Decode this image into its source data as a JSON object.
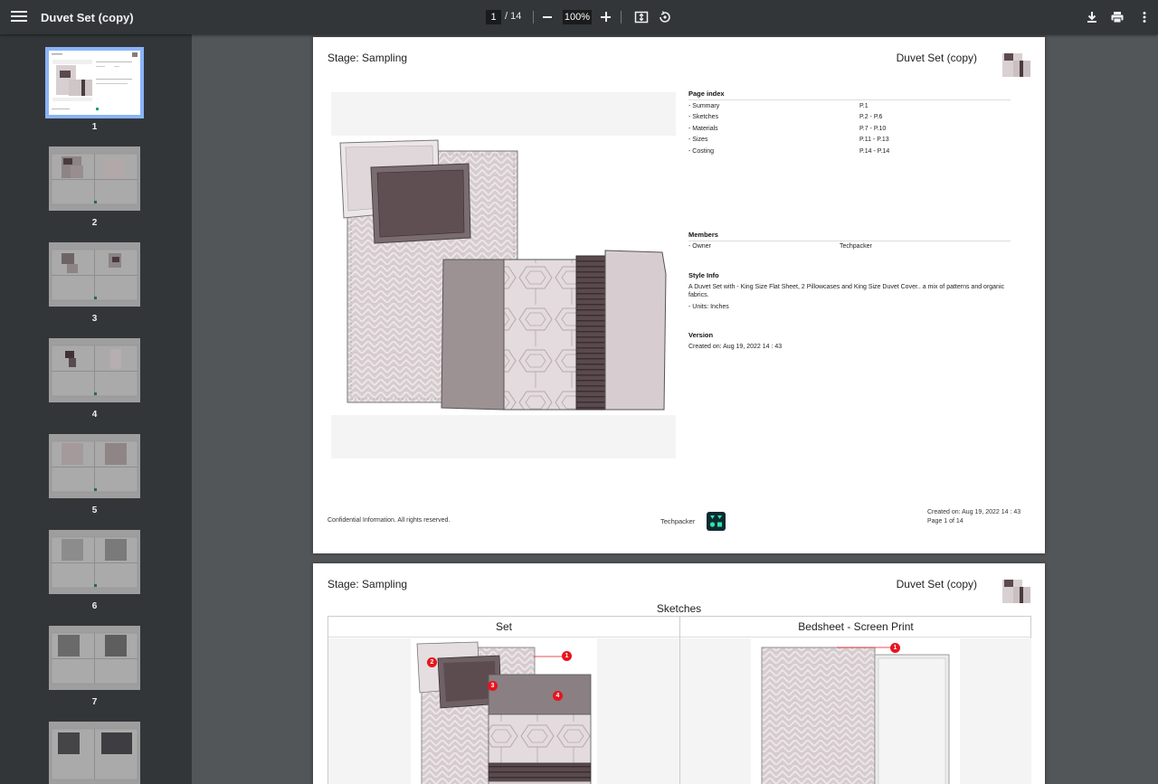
{
  "toolbar": {
    "title": "Duvet Set (copy)",
    "current_page": "1",
    "total_pages": "/ 14",
    "zoom": "100%"
  },
  "thumbnails": [
    {
      "label": "1"
    },
    {
      "label": "2"
    },
    {
      "label": "3"
    },
    {
      "label": "4"
    },
    {
      "label": "5"
    },
    {
      "label": "6"
    },
    {
      "label": "7"
    }
  ],
  "page1": {
    "stage": "Stage: Sampling",
    "title": "Duvet Set (copy)",
    "page_index_heading": "Page index",
    "page_index": [
      {
        "name": "- Summary",
        "pages": "P.1"
      },
      {
        "name": "- Sketches",
        "pages": "P.2 - P.6"
      },
      {
        "name": "- Materials",
        "pages": "P.7 - P.10"
      },
      {
        "name": "- Sizes",
        "pages": "P.11 - P.13"
      },
      {
        "name": "- Costing",
        "pages": "P.14 - P.14"
      }
    ],
    "members_heading": "Members",
    "member_role": "- Owner",
    "member_name": "Techpacker",
    "style_info_heading": "Style Info",
    "style_info_text": "A Duvet Set with - King Size Flat Sheet, 2 Pillowcases and King Size Duvet Cover.. a mix of patterns and organic fabrics.",
    "units": "- Units: Inches",
    "version_heading": "Version",
    "created_on": "Created on: Aug 19, 2022 14 : 43",
    "footer_left": "Confidential Information. All rights reserved.",
    "footer_brand": "Techpacker",
    "footer_created": "Created on: Aug 19, 2022 14 : 43",
    "footer_page": "Page 1 of 14"
  },
  "page2": {
    "stage": "Stage: Sampling",
    "title": "Duvet Set (copy)",
    "section": "Sketches",
    "col_left": "Set",
    "col_right": "Bedsheet - Screen Print",
    "badges_left": [
      "1",
      "2",
      "3",
      "4"
    ],
    "badges_right": [
      "1"
    ]
  },
  "colors": {
    "toolbar": "#323639",
    "viewer_bg": "#525659",
    "accent": "#8ab4f8",
    "brand_teal": "#16a085",
    "badge_red": "#e8141e"
  }
}
